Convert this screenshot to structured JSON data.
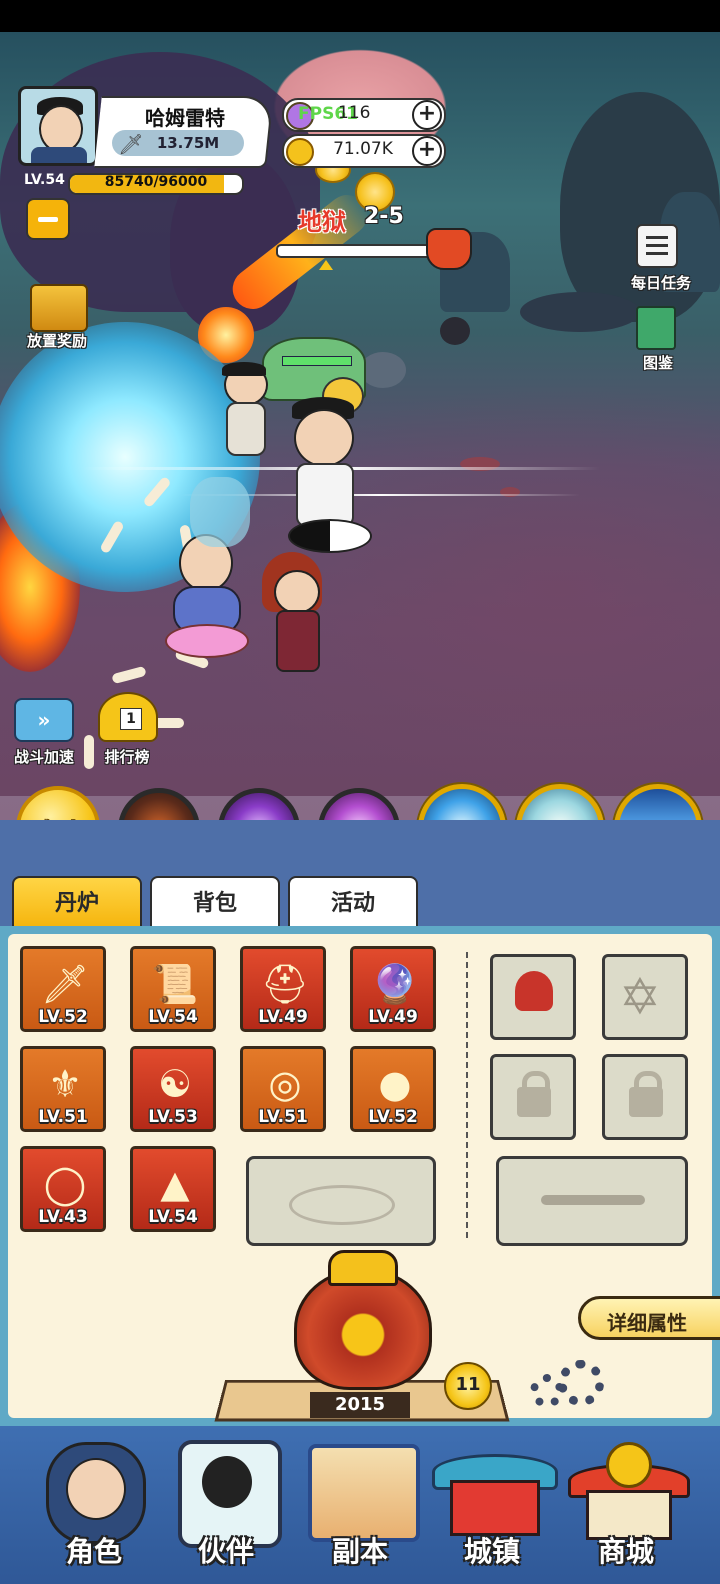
{
  "player": {
    "name": "哈姆雷特",
    "power": "13.75M",
    "level": "LV.54",
    "exp": "85740/96000",
    "exp_fraction": 0.893
  },
  "currency": {
    "gems": "116",
    "gems_overlay": "FPS61",
    "gold": "71.07K"
  },
  "stage": {
    "name": "地狱",
    "level": "2-5",
    "progress_fraction": 0.15
  },
  "left_menu": {
    "idle_rewards": "放置奖励",
    "battle_speed": "战斗加速",
    "leaderboard": "排行榜",
    "leaderboard_badge": "1"
  },
  "right_menu": {
    "daily_tasks": "每日任务",
    "codex": "图鉴"
  },
  "skills": {
    "auto_label": "自动"
  },
  "tabs": [
    {
      "label": "丹炉",
      "active": true
    },
    {
      "label": "背包",
      "active": false
    },
    {
      "label": "活动",
      "active": false
    }
  ],
  "equipment": [
    {
      "level": "LV.52",
      "icon": "sword-icon",
      "tier": "orange"
    },
    {
      "level": "LV.54",
      "icon": "scroll-icon",
      "tier": "orange"
    },
    {
      "level": "LV.49",
      "icon": "horned-helmet-icon",
      "tier": "red"
    },
    {
      "level": "LV.49",
      "icon": "crystal-orb-icon",
      "tier": "red"
    },
    {
      "level": "LV.51",
      "icon": "armor-icon",
      "tier": "orange"
    },
    {
      "level": "LV.53",
      "icon": "bagua-icon",
      "tier": "red"
    },
    {
      "level": "LV.51",
      "icon": "jade-ring-icon",
      "tier": "orange"
    },
    {
      "level": "LV.52",
      "icon": "gourd-icon",
      "tier": "orange"
    },
    {
      "level": "LV.43",
      "icon": "ring-icon",
      "tier": "red"
    },
    {
      "level": "LV.54",
      "icon": "boots-icon",
      "tier": "red"
    }
  ],
  "furnace": {
    "count": "2015",
    "level_badge": "11",
    "detail_button": "详细属性"
  },
  "nav": [
    {
      "label": "角色"
    },
    {
      "label": "伙伴"
    },
    {
      "label": "副本"
    },
    {
      "label": "城镇"
    },
    {
      "label": "商城"
    }
  ],
  "colors": {
    "tab_active": "#f5b30a",
    "panel_border": "#5fa9c6",
    "panel_bg": "#fbf3dc",
    "navbar": "#3f6fb2",
    "slot_orange": "#e47a29",
    "slot_red": "#e24b2d"
  }
}
